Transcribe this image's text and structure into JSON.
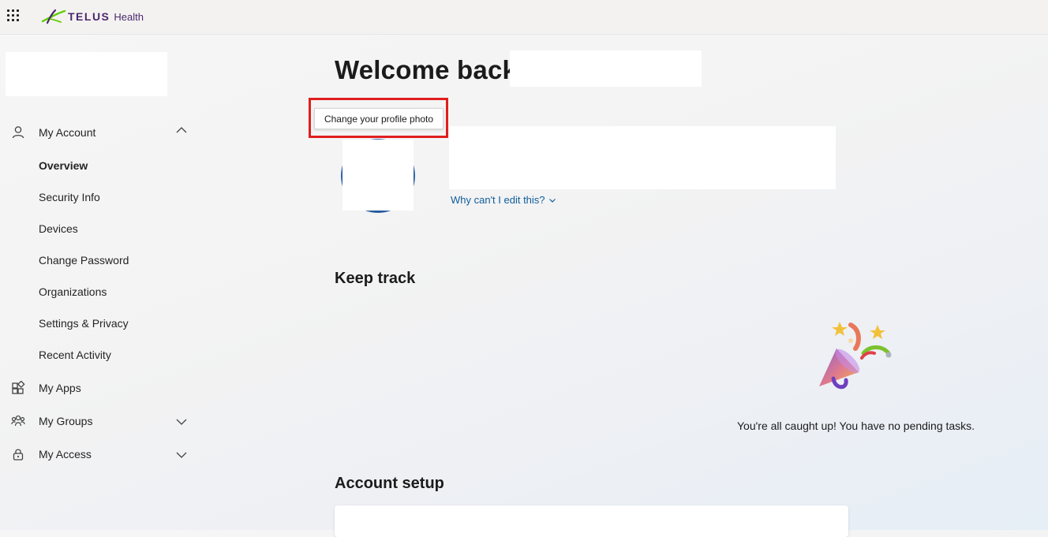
{
  "header": {
    "brand": "TELUS",
    "brand_sub": "Health",
    "apps_icon": "waffle-icon"
  },
  "sidebar": {
    "items": [
      {
        "label": "My Account",
        "icon": "person-icon",
        "expanded": true
      },
      {
        "label": "My Apps",
        "icon": "apps-icon"
      },
      {
        "label": "My Groups",
        "icon": "groups-icon",
        "expanded": false
      },
      {
        "label": "My Access",
        "icon": "lock-icon",
        "expanded": false
      }
    ],
    "account_subitems": [
      "Overview",
      "Security Info",
      "Devices",
      "Change Password",
      "Organizations",
      "Settings & Privacy",
      "Recent Activity"
    ],
    "active_subitem": "Overview"
  },
  "main": {
    "welcome": "Welcome back,",
    "tooltip": "Change your profile photo",
    "why_link": "Why can't I edit this?",
    "keep_track": "Keep track",
    "empty_message": "You're all caught up! You have no pending tasks.",
    "account_setup": "Account setup"
  },
  "colors": {
    "brand_purple": "#4b286d",
    "brand_green": "#66cc00",
    "link_blue": "#0f5c9c",
    "highlight_red": "#e01e1e"
  }
}
